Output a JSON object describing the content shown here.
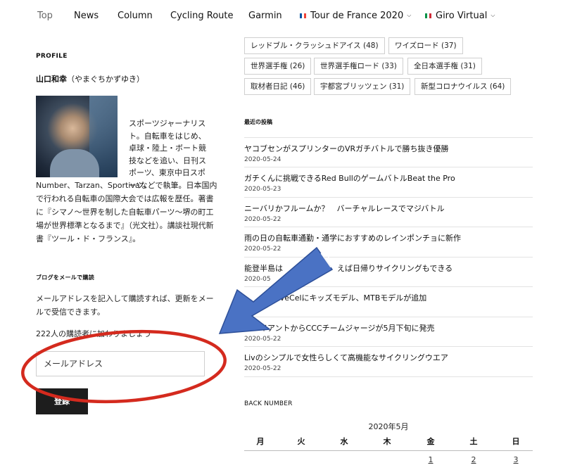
{
  "nav": {
    "items": [
      "Top",
      "News",
      "Column",
      "Cycling Route",
      "Garmin"
    ],
    "tdf": "Tour de France 2020",
    "giro": "Giro Virtual"
  },
  "tags": [
    "レッドブル・クラッシュドアイス (48)",
    "ワイズロード (37)",
    "世界選手権 (26)",
    "世界選手権ロード (33)",
    "全日本選手権 (31)",
    "取材者日記 (46)",
    "宇都宮ブリッツェン (31)",
    "新型コロナウイルス (64)"
  ],
  "profile": {
    "heading": "PROFILE",
    "name": "山口和幸",
    "reading": "（やまぐちかずゆき）",
    "bio_a": "スポーツジャーナリスト。自転車をはじめ、卓球・陸上・ボート競技などを追い、日刊スポーツ、東京中日スポーツ、",
    "bio_b": "Number、Tarzan、Sportivaなどで執筆。日本国内で行われる自転車の国際大会では広報を歴任。著書に『シマノ〜世界を制した自転車パーツ〜堺の町工場が世界標準となるまで』（光文社）。講談社現代新書『ツール・ド・フランス』。"
  },
  "subscribe": {
    "heading": "ブログをメールで購読",
    "text": "メールアドレスを記入して購読すれば、更新をメールで受信できます。",
    "count": "222人の購読者に加わりましょう",
    "placeholder": "メールアドレス",
    "button": "登録"
  },
  "recent": {
    "heading": "最近の投稿",
    "posts": [
      {
        "title": "ヤコブセンがスプリンターのVRガチバトルで勝ち抜き優勝",
        "date": "2020-05-24"
      },
      {
        "title": "ガチくんに挑戦できるRed BullのゲームバトルBeat the Pro",
        "date": "2020-05-23"
      },
      {
        "title": "ニーバリかフルームか？　バーチャルレースでマジバトル",
        "date": "2020-05-22"
      },
      {
        "title": "雨の日の自転車通勤・通学におすすめのレインポンチョに新作",
        "date": "2020-05-22"
      },
      {
        "title": "能登半島は　　　　　　　えば日帰りサイクリングもできる",
        "date": "2020-05"
      },
      {
        "title": "　　　　aveCelにキッズモデル、MTBモデルが追加",
        "date": ""
      },
      {
        "title": "　　イアントからCCCチームジャージが5月下旬に発売",
        "date": "2020-05-22"
      },
      {
        "title": "Livのシンプルで女性らしくて高機能なサイクリングウエア",
        "date": "2020-05-22"
      }
    ]
  },
  "back_number": {
    "heading": "BACK NUMBER",
    "month": "2020年5月",
    "weekdays": [
      "月",
      "火",
      "水",
      "木",
      "金",
      "土",
      "日"
    ],
    "row1": [
      "1",
      "2",
      "3"
    ]
  },
  "colors": {
    "circle": "#d42a1e",
    "arrow": "#4a72c4",
    "arrow_stroke": "#2d4f98",
    "flag_fr": [
      "#0055a4",
      "#ffffff",
      "#ef4135"
    ],
    "flag_it": [
      "#009246",
      "#ffffff",
      "#ce2b37"
    ]
  }
}
